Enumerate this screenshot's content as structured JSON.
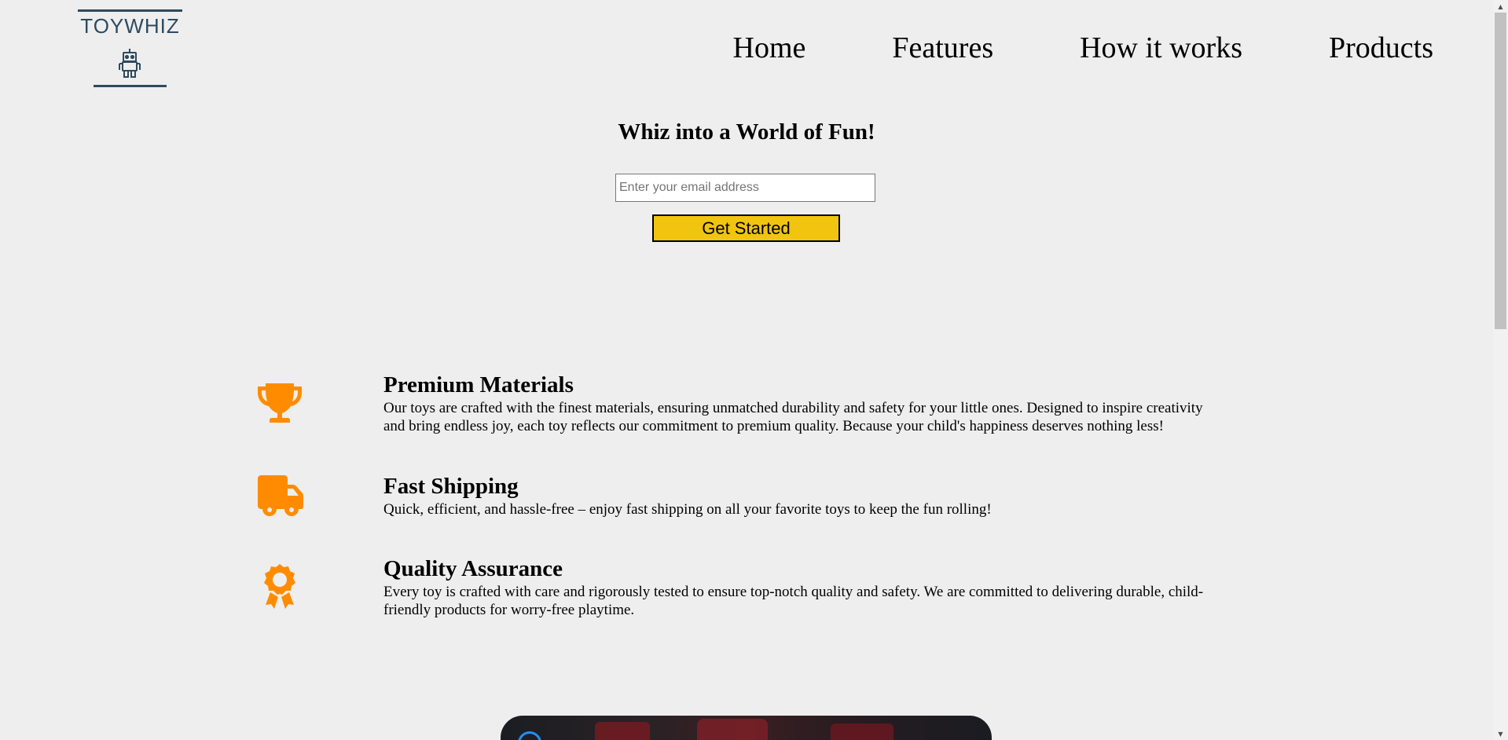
{
  "brand": {
    "name": "TOYWHIZ",
    "logo_icon": "robot-icon",
    "color": "#2e4a5e"
  },
  "nav": {
    "items": [
      {
        "label": "Home"
      },
      {
        "label": "Features"
      },
      {
        "label": "How it works"
      },
      {
        "label": "Products"
      }
    ]
  },
  "hero": {
    "title": "Whiz into a World of Fun!",
    "email_placeholder": "Enter your email address",
    "email_value": "",
    "cta_label": "Get Started",
    "cta_color": "#f1c40f"
  },
  "features": {
    "icon_color": "#ff8c00",
    "items": [
      {
        "icon": "trophy-icon",
        "title": "Premium Materials",
        "description_lines": [
          "Our toys are crafted with the finest materials, ensuring unmatched durability and safety for your little ones. Designed to inspire creativity",
          "and bring endless joy, each toy reflects our commitment to premium quality. Because your child's happiness deserves nothing less!"
        ]
      },
      {
        "icon": "truck-icon",
        "title": "Fast Shipping",
        "description_lines": [
          "Quick, efficient, and hassle-free – enjoy fast shipping on all your favorite toys to keep the fun rolling!"
        ]
      },
      {
        "icon": "award-ribbon-icon",
        "title": "Quality Assurance",
        "description_lines": [
          "Every toy is crafted with care and rigorously tested to ensure top-notch quality and safety. We are committed to delivering durable, child-",
          "friendly products for worry-free playtime."
        ]
      }
    ]
  }
}
